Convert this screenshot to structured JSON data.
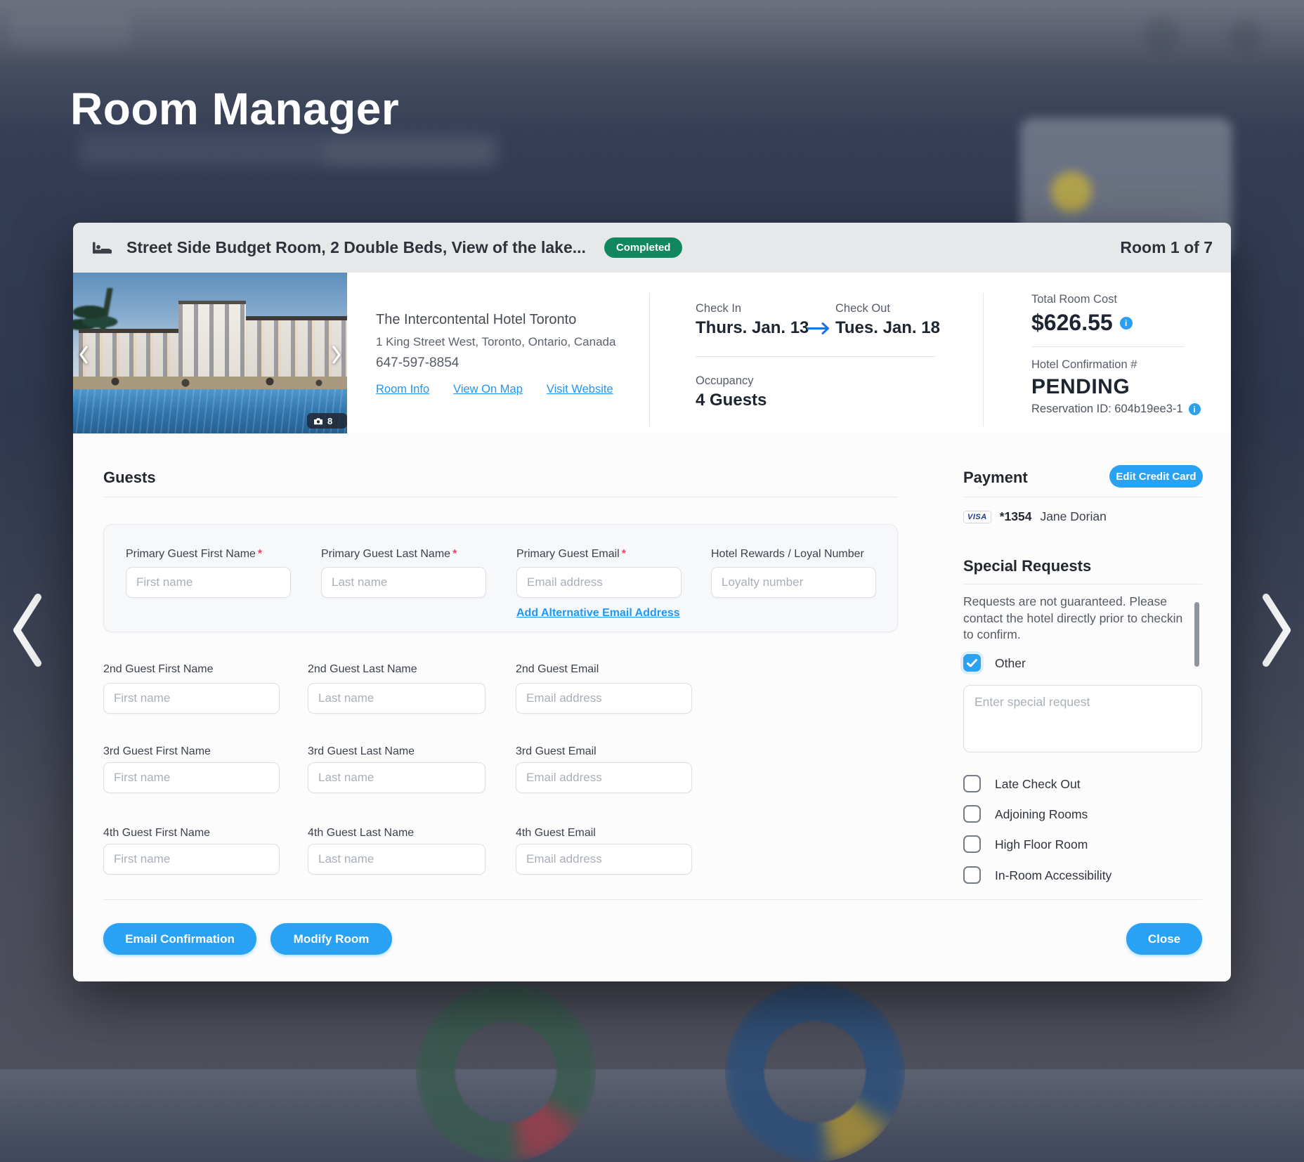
{
  "colors": {
    "accent_blue": "#29A2F4",
    "link_blue": "#2196F3",
    "badge_green": "#11875F",
    "dark_text": "#1D2531",
    "required_red": "#E5446D",
    "backdrop_navy": "#2F384F"
  },
  "backdrop": {
    "page_title": "Room Manager"
  },
  "modal": {
    "header": {
      "room_title": "Street Side Budget Room, 2 Double Beds, View of the lake...",
      "status_badge": "Completed",
      "room_counter": "Room 1 of 7"
    },
    "carousel": {
      "photo_count": "8"
    },
    "hotel": {
      "name": "The Intercontental Hotel Toronto",
      "address": "1 King Street West, Toronto, Ontario, Canada",
      "phone": "647-597-8854",
      "links": {
        "room_info": "Room Info",
        "view_on_map": "View On Map",
        "visit_website": "Visit Website"
      }
    },
    "stay": {
      "check_in_label": "Check In",
      "check_in_value": "Thurs. Jan. 13",
      "check_out_label": "Check Out",
      "check_out_value": "Tues. Jan. 18",
      "occupancy_label": "Occupancy",
      "occupancy_value": "4 Guests"
    },
    "cost": {
      "total_label": "Total Room Cost",
      "total_value": "$626.55",
      "confirmation_label": "Hotel Confirmation #",
      "confirmation_value": "PENDING",
      "reservation_id": "Reservation ID: 604b19ee3-1"
    },
    "guests": {
      "heading": "Guests",
      "required_mark": "*",
      "primary_fields": [
        {
          "label": "Primary Guest First Name",
          "placeholder": "First name"
        },
        {
          "label": "Primary Guest Last Name",
          "placeholder": "Last name"
        },
        {
          "label": "Primary Guest Email",
          "placeholder": "Email address"
        },
        {
          "label": "Hotel Rewards / Loyal Number",
          "placeholder": "Loyalty number"
        }
      ],
      "alt_email_link": "Add Alternative Email Address",
      "rows": [
        {
          "fields": [
            {
              "label": "2nd Guest First Name",
              "placeholder": "First name"
            },
            {
              "label": "2nd Guest Last Name",
              "placeholder": "Last name"
            },
            {
              "label": "2nd Guest Email",
              "placeholder": "Email address"
            }
          ]
        },
        {
          "fields": [
            {
              "label": "3rd Guest First Name",
              "placeholder": "First name"
            },
            {
              "label": "3rd Guest Last Name",
              "placeholder": "Last name"
            },
            {
              "label": "3rd Guest Email",
              "placeholder": "Email address"
            }
          ]
        },
        {
          "fields": [
            {
              "label": "4th Guest First Name",
              "placeholder": "First name"
            },
            {
              "label": "4th Guest Last Name",
              "placeholder": "Last name"
            },
            {
              "label": "4th Guest Email",
              "placeholder": "Email address"
            }
          ]
        }
      ]
    },
    "payment": {
      "heading": "Payment",
      "edit_button": "Edit Credit Card",
      "card_brand": "VISA",
      "card_last4": "*1354",
      "card_holder": "Jane Dorian"
    },
    "special_requests": {
      "heading": "Special Requests",
      "note": "Requests are not guaranteed. Please contact the hotel directly prior to checkin to confirm.",
      "other_label": "Other",
      "textarea_placeholder": "Enter special request",
      "options": [
        "Late Check Out",
        "Adjoining Rooms",
        "High Floor Room",
        "In-Room Accessibility"
      ]
    },
    "actions": {
      "email_confirmation": "Email Confirmation",
      "modify_room": "Modify Room",
      "close": "Close"
    },
    "icons": {
      "info_glyph": "i"
    }
  }
}
